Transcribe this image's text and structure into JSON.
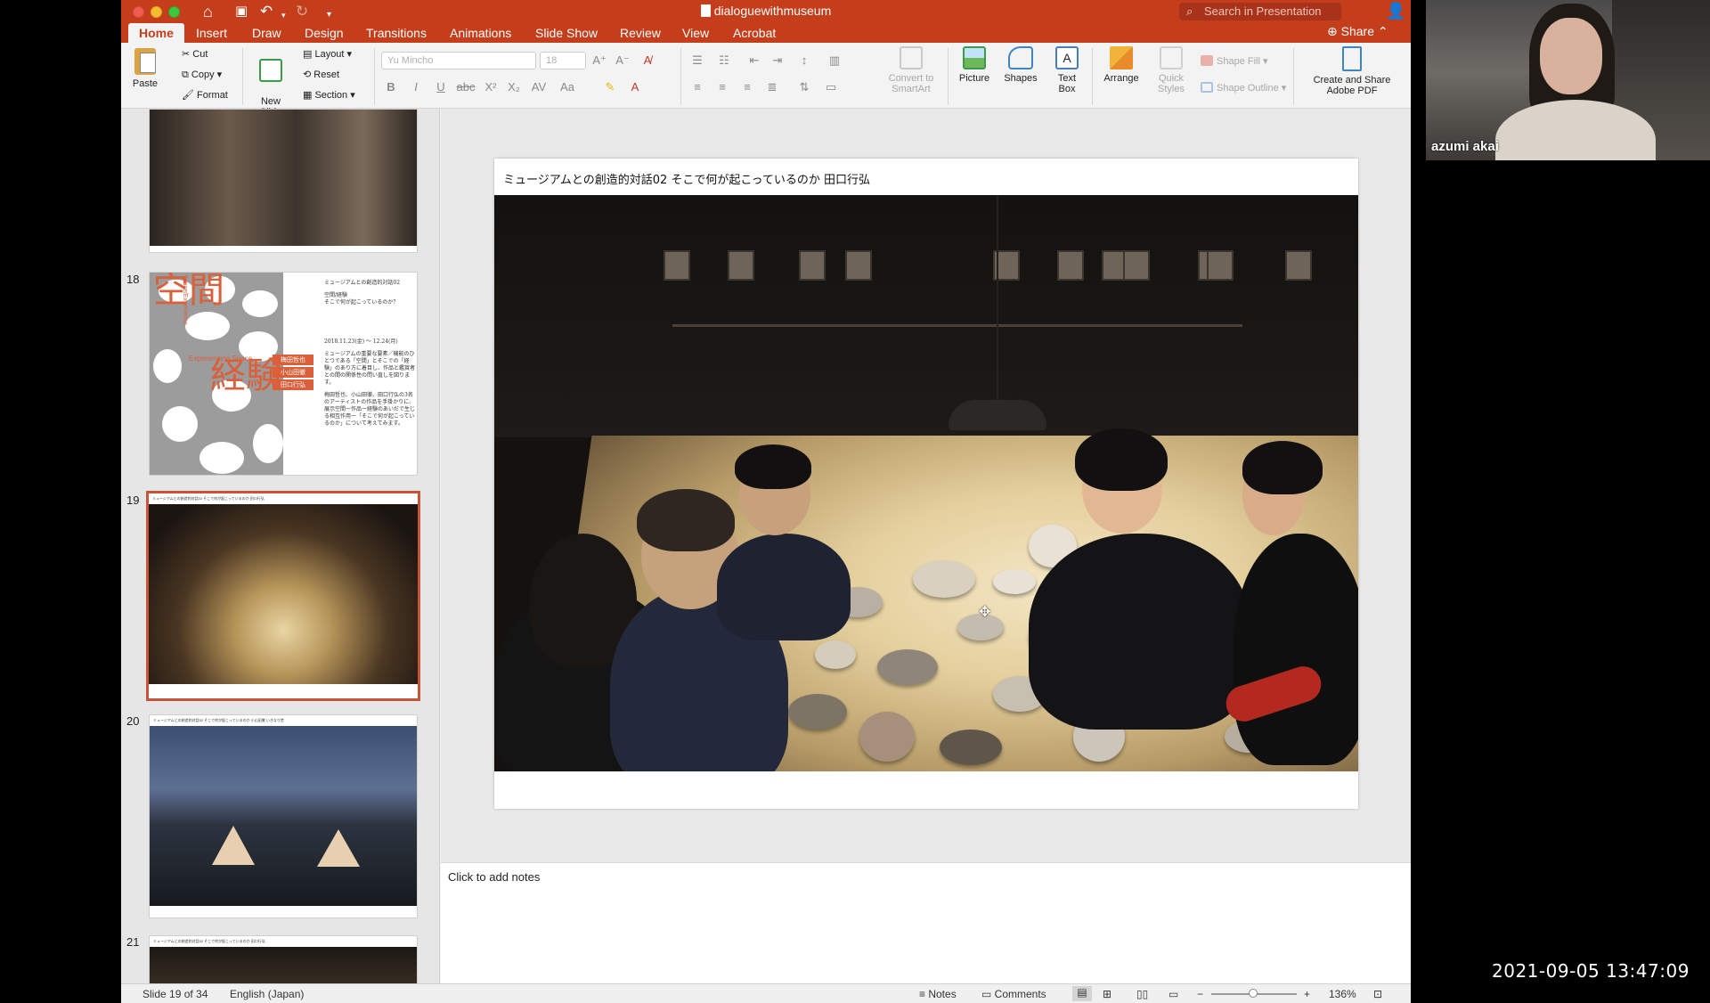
{
  "window": {
    "title": "dialoguewithmuseum",
    "search_placeholder": "Search in Presentation"
  },
  "tabs": [
    "Home",
    "Insert",
    "Draw",
    "Design",
    "Transitions",
    "Animations",
    "Slide Show",
    "Review",
    "View",
    "Acrobat"
  ],
  "share_label": "Share",
  "ribbon": {
    "paste": "Paste",
    "cut": "Cut",
    "copy": "Copy",
    "format": "Format",
    "new_slide": "New\nSlide",
    "layout": "Layout",
    "reset": "Reset",
    "section": "Section",
    "font_name": "Yu Mincho",
    "font_size": "18",
    "convert_smartart": "Convert to SmartArt",
    "picture": "Picture",
    "shapes": "Shapes",
    "text_box": "Text Box",
    "arrange": "Arrange",
    "quick_styles": "Quick Styles",
    "shape_fill": "Shape Fill",
    "shape_outline": "Shape Outline",
    "create_share_pdf": "Create and Share Adobe PDF"
  },
  "thumbnails": {
    "slide18": {
      "num": "18",
      "kanji_top": "空間",
      "kanji_bottom": "経験",
      "en_vertical": "Space/Experience",
      "en_title": "Experiencing Space",
      "names": [
        "梅田哲也",
        "小山田徹",
        "田口行弘"
      ],
      "text_lines": [
        "ミュージアムとの創造的対話02",
        "空間/経験",
        "そこで何が起こっているのか？",
        "2018.11.23(金) ～ 12.24(月)",
        "ミュージアムの重要な要素／機能のひとつである「空間」とそこでの「経験」のあり方に着目し、作品と鑑賞者との間の関係性の問い直しを図ります。",
        "梅田哲也、小山田徹、田口行弘の3名のアーティストの作品を手掛かりに、展示空間ー作品ー経験のあいだで生じる相互作用ー「そこで何が起こっているのか」について考えてみます。"
      ]
    },
    "slide19": {
      "num": "19",
      "header": "ミュージアムとの創造的対話02 そこで何が起こっているのか 田口行弘"
    },
    "slide20": {
      "num": "20",
      "header": "ミュージアムとの創造的対話02 そこで何が起こっているのか 小山田徹 いきなり焚"
    },
    "slide21": {
      "num": "21",
      "header": "ミュージアムとの創造的対話02 そこで何が起こっているのか 田口行弘"
    }
  },
  "slide": {
    "title": "ミュージアムとの創造的対話02 そこで何が起こっているのか 田口行弘"
  },
  "notes_placeholder": "Click to add notes",
  "status": {
    "slide_of": "Slide 19 of 34",
    "language": "English (Japan)",
    "notes": "Notes",
    "comments": "Comments",
    "zoom": "136%"
  },
  "webcam": {
    "name": "azumi akai"
  },
  "timestamp": "2021-09-05 13:47:09",
  "colors": {
    "accent": "#c43e1c",
    "selection": "#c6553a",
    "poster_orange": "#d9603a"
  }
}
